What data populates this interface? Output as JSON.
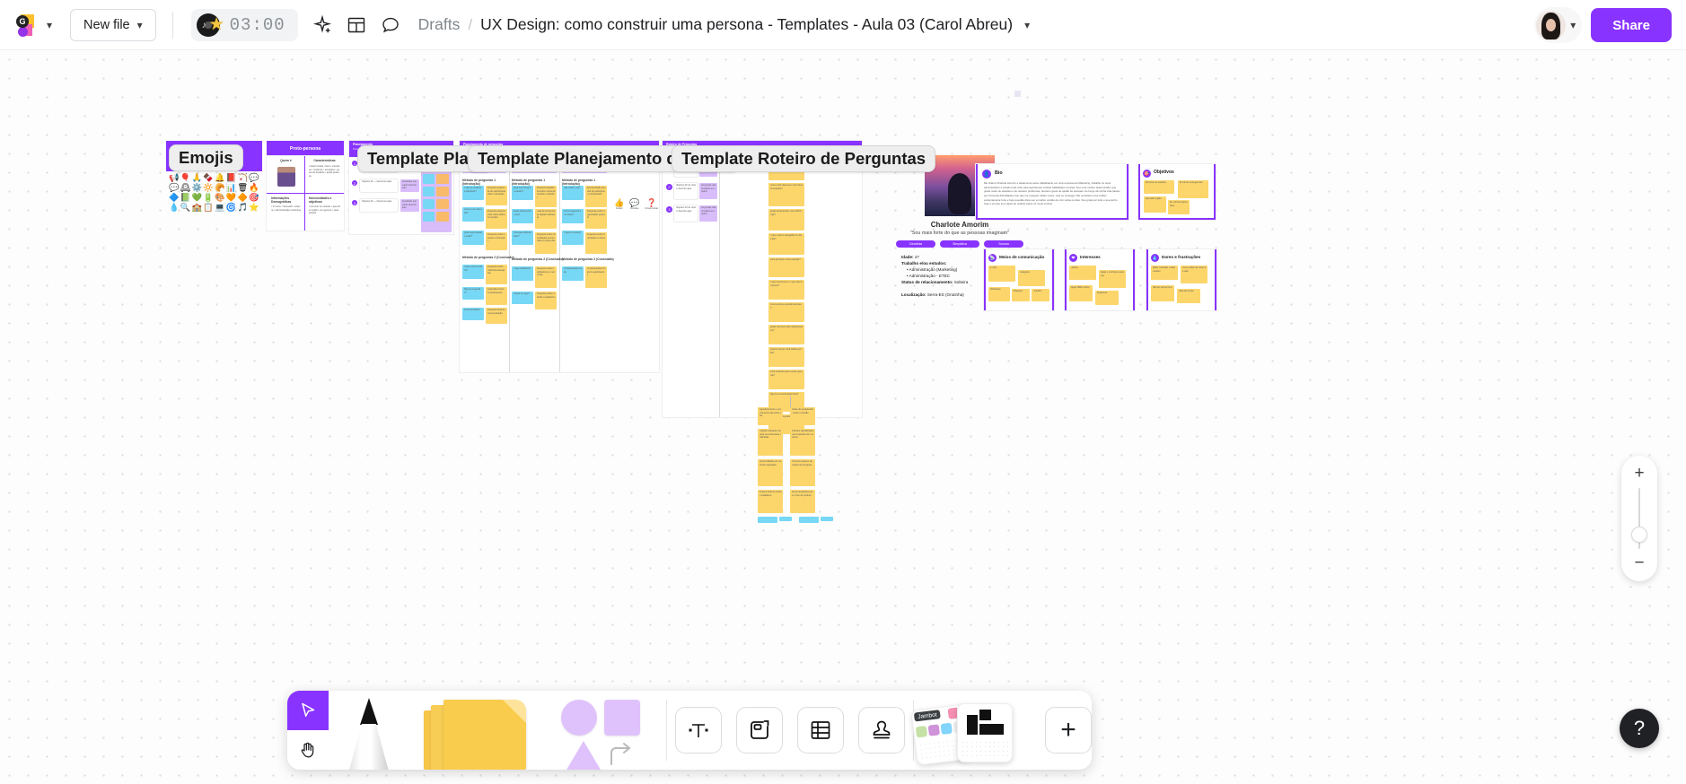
{
  "app": {
    "name": "Jamboard",
    "accent_color": "#8833ff",
    "canvas_bg": "#fdfdfd"
  },
  "header": {
    "logo_icon": "jamboard-logo-icon",
    "logo_caret": "chevron-down-icon",
    "new_file_label": "New file",
    "new_file_caret": "chevron-down-icon",
    "timer": {
      "icon": "music-timer-icon",
      "value": "03:00"
    },
    "icons": {
      "magic": "sparkle-icon",
      "layout": "layout-template-icon",
      "comment": "comment-bubble-icon"
    },
    "breadcrumb": {
      "root": "Drafts",
      "separator": "/",
      "title": "UX Design: como construir uma persona - Templates - Aula 03 (Carol Abreu)",
      "caret": "chevron-down-icon"
    },
    "avatar_caret": "chevron-down-icon",
    "share_label": "Share"
  },
  "canvas": {
    "frames": [
      {
        "id": "emojis",
        "label": "Emojis"
      },
      {
        "id": "proto",
        "label": "Proto-persona"
      },
      {
        "id": "tpl-pla",
        "label": "Template Pla..."
      },
      {
        "id": "tpl-plan",
        "label": "Template Planejamento de per..."
      },
      {
        "id": "tpl-rot",
        "label": "Template Roteiro de Perguntas"
      }
    ],
    "proto_persona": {
      "title": "Proto-persona",
      "sections": [
        "Quem é",
        "Características",
        "Informações Demográficas",
        "Necessidades e objetivos"
      ]
    },
    "persona": {
      "name": "Charlote Amorim",
      "quote": "\"Sou mais forte do que as pessoas imaginam\"",
      "tags": [
        "Decidida",
        "Simpática",
        "Sonora"
      ],
      "fields": [
        {
          "label": "Idade:",
          "value": "27"
        },
        {
          "label": "Trabalho e/ou estudos:",
          "value": ""
        },
        {
          "label": "Status de relacionamento:",
          "value": "Solteira"
        },
        {
          "label": "Localização:",
          "value": "Serra-ES (Grutinha)"
        }
      ],
      "studies": [
        "Administração (Marketing)",
        "Administração - ETEC"
      ],
      "cards": [
        {
          "id": "bio",
          "icon": "person-icon",
          "title": "Bio"
        },
        {
          "id": "objetivos",
          "icon": "target-icon",
          "title": "Objetivos"
        },
        {
          "id": "meios",
          "icon": "network-icon",
          "title": "Meios de comunicação"
        },
        {
          "id": "interesses",
          "icon": "heart-icon",
          "title": "Interesses"
        },
        {
          "id": "dores",
          "icon": "drop-icon",
          "title": "Dores e frustrações"
        }
      ],
      "bio_text": "Me chamo Charlote Amorim e atualmente estou trabalhando em uma empresa de Marketing, trabalho no setor administrativo e estudo pela noite para aperfeiçoar minhas habilidades na área. Sou uma mulher determinada, que gosta muito de desafios e de resolver problemas, também gosto de ajudar as pessoas. Ao longo da minha vida passei por inúmeras dificuldades, tive que me reerguer várias vezes, mas eu consegui. Me considero uma mulher extremamente forte e faço questão disso ser a melhor versão de mim todos os dias. Sou grata por tudo o que tenho hoje e sei que sou capaz de realizar todos os meus sonhos.",
      "objetivos_notes": [
        "Terminar os estudos",
        "Aprender inglês",
        "Se tornar uma gerente",
        "Ter minha própria casa"
      ],
      "meios_notes": [
        "E-mail",
        "Instagram",
        "WhatsApp",
        "Telegram",
        "LinkedIn"
      ],
      "interesses_notes": [
        "Leitura",
        "Viajar e conhecer pessoas",
        "Jogar MMO online",
        "Academia"
      ],
      "dores_notes": [
        "Saber controlar o lado emotivo",
        "Como voltar ao início da vida",
        "Não ter tempo livre",
        "Falta de tempo"
      ]
    }
  },
  "toolbar": {
    "modes": [
      {
        "name": "select-tool",
        "icon": "cursor-arrow-icon",
        "active": true
      },
      {
        "name": "pan-tool",
        "icon": "hand-icon",
        "active": false
      }
    ],
    "creative": [
      {
        "name": "pen-tool",
        "icon": "pen-icon"
      },
      {
        "name": "sticky-note-tool",
        "icon": "sticky-notes-icon"
      },
      {
        "name": "shapes-tool",
        "icon": "shapes-icon"
      }
    ],
    "objects": [
      {
        "name": "text-tool",
        "icon": "text-t-icon"
      },
      {
        "name": "frame-tool",
        "icon": "frame-icon"
      },
      {
        "name": "table-tool",
        "icon": "table-icon"
      },
      {
        "name": "stamp-tool",
        "icon": "stamp-icon"
      }
    ],
    "widgets": {
      "cluster_label": "Jambot",
      "add_label": "+",
      "add_name": "add-widget-button"
    }
  },
  "zoom_controls": {
    "zoom_in": "+",
    "zoom_out": "−",
    "slider_name": "zoom-slider"
  },
  "help": {
    "label": "?"
  }
}
